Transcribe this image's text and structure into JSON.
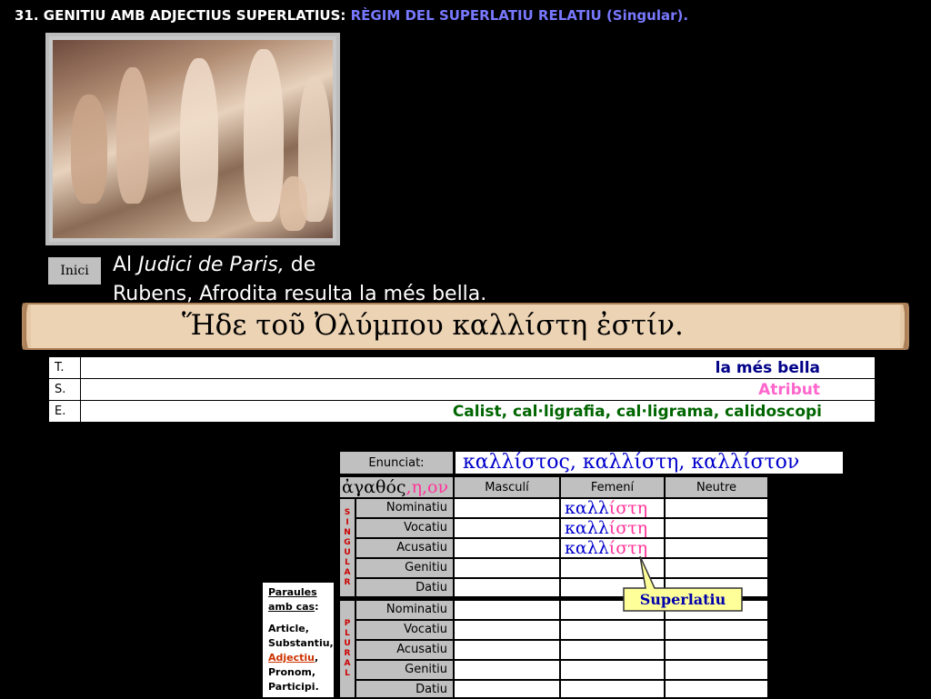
{
  "header": {
    "number_title": "31. GENITIU AMB ADJECTIUS SUPERLATIUS:",
    "subtitle": "RÈGIM DEL SUPERLATIU RELATIU (Singular)."
  },
  "painting": {
    "subject": "judgement-of-paris-painting"
  },
  "nav": {
    "home_label": "Inici"
  },
  "caption": {
    "line1_a": "Al ",
    "line1_italic": "Judici de Paris,",
    "line1_b": " de",
    "line2": "Rubens, Afrodita resulta la més bella."
  },
  "banner": {
    "greek_sentence": "Ἥδε τοῦ Ὀλύμπου καλλίστη ἐστίν."
  },
  "tse": {
    "rows": [
      {
        "label": "T.",
        "value": "la més bella"
      },
      {
        "label": "S.",
        "value": "Atribut"
      },
      {
        "label": "E.",
        "value": "Calist, cal·ligrafia, cal·ligrama, calidoscopi"
      }
    ]
  },
  "declension": {
    "enunciat_label": "Enunciat:",
    "enunciat_value": "καλλίστος, καλλίστη, καλλίστον",
    "lemma_stem": "ἀγαθός",
    "lemma_endings": ",η,ον",
    "col_masculi": "Masculí",
    "col_femeni": "Femení",
    "col_neutre": "Neutre",
    "singular_label": "SINGULAR",
    "plural_label": "PLURAL",
    "cases": [
      "Nominatiu",
      "Vocatiu",
      "Acusatiu",
      "Genitiu",
      "Datiu"
    ],
    "femeni_stem": "καλλ",
    "femeni_ending": "ίστη",
    "callout": "Superlatiu"
  },
  "paraules": {
    "title_1": "Paraules",
    "title_2": "amb cas",
    "items": [
      "Article,",
      "Substantiu,",
      "Adjectiu",
      "Pronom,",
      "Participi."
    ]
  },
  "colors": {
    "background": "#000000",
    "header_blue": "#7878ff",
    "greek_blue": "#0000cc",
    "ending_pink": "#ff3399"
  }
}
